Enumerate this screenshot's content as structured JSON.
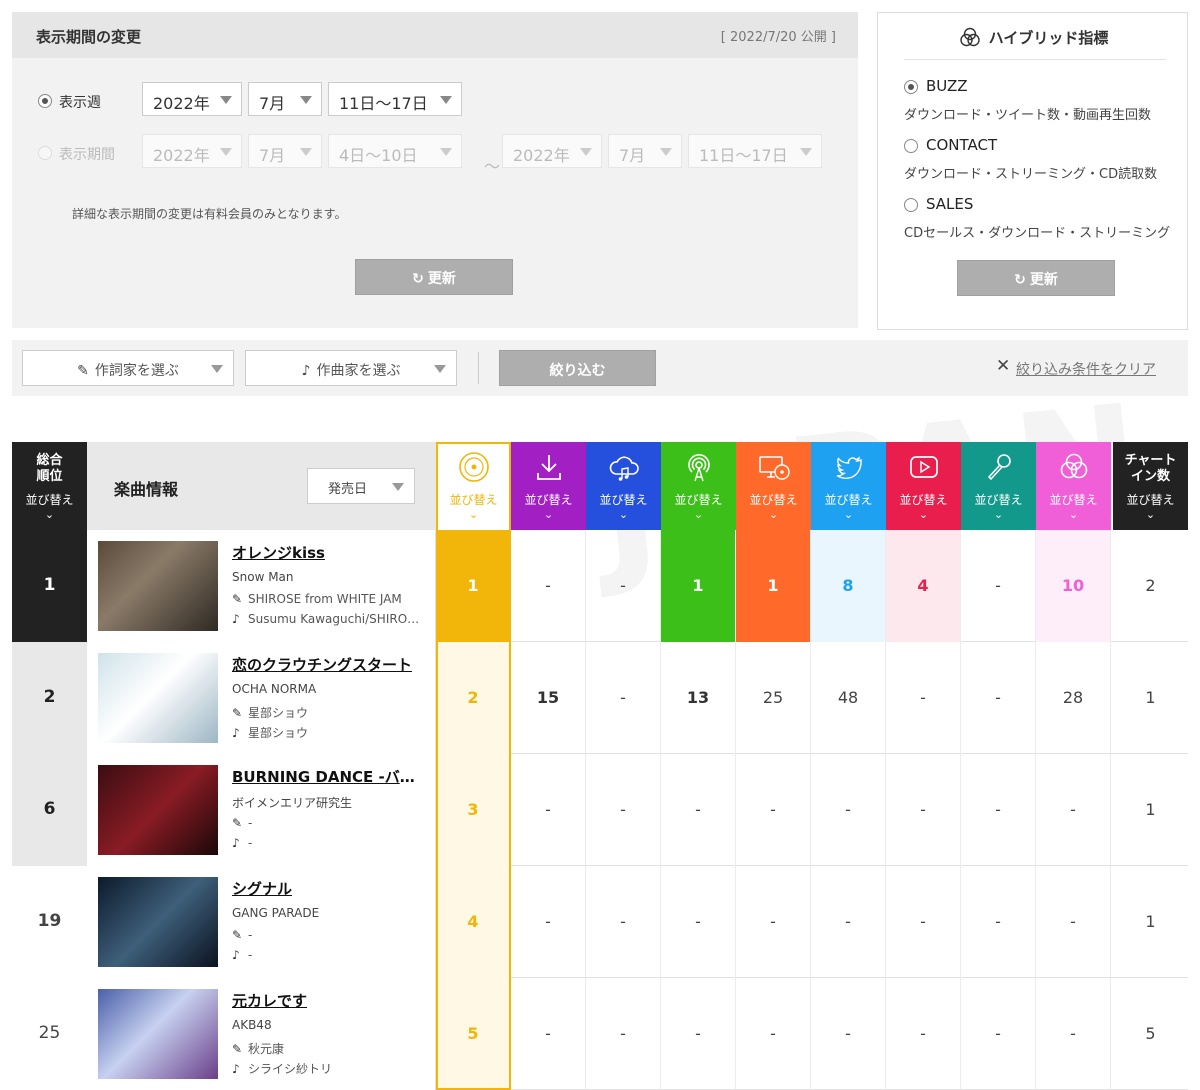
{
  "period": {
    "title": "表示期間の変更",
    "published": "[ 2022/7/20 公開 ]",
    "week_label": "表示週",
    "range_label": "表示期間",
    "week": {
      "year": "2022年",
      "month": "7月",
      "days": "11日～17日"
    },
    "range_from": {
      "year": "2022年",
      "month": "7月",
      "days": "4日～10日"
    },
    "tilde": "～",
    "range_to": {
      "year": "2022年",
      "month": "7月",
      "days": "11日～17日"
    },
    "note": "詳細な表示期間の変更は有料会員のみとなります。",
    "refresh_label": "更新"
  },
  "hybrid": {
    "title": "ハイブリッド指標",
    "options": [
      {
        "name": "BUZZ",
        "desc": "ダウンロード・ツイート数・動画再生回数",
        "selected": true
      },
      {
        "name": "CONTACT",
        "desc": "ダウンロード・ストリーミング・CD読取数",
        "selected": false
      },
      {
        "name": "SALES",
        "desc": "CDセールス・ダウンロード・ストリーミング",
        "selected": false
      }
    ],
    "refresh_label": "更新"
  },
  "filter": {
    "lyricist_placeholder": "作詞家を選ぶ",
    "composer_placeholder": "作曲家を選ぶ",
    "apply_label": "絞り込む",
    "clear_label": "絞り込み条件をクリア"
  },
  "watermark": "JAPAN",
  "table": {
    "header": {
      "rank_title_1": "総合",
      "rank_title_2": "順位",
      "sort_label": "並び替え",
      "info_title": "楽曲情報",
      "date_select": "発売日",
      "chartin_title_1": "チャート",
      "chartin_title_2": "イン数"
    },
    "columns": [
      {
        "key": "buzz",
        "icon": "hybrid-disc-icon",
        "color": "#f2b50a"
      },
      {
        "key": "download",
        "icon": "download-icon",
        "color": "#a21fc4"
      },
      {
        "key": "streaming",
        "icon": "cloud-music-icon",
        "color": "#2550dd"
      },
      {
        "key": "radio",
        "icon": "radio-icon",
        "color": "#3cbf18"
      },
      {
        "key": "cd",
        "icon": "pc-cd-icon",
        "color": "#ff6a2a"
      },
      {
        "key": "twitter",
        "icon": "twitter-icon",
        "color": "#1fa1f2"
      },
      {
        "key": "video",
        "icon": "video-play-icon",
        "color": "#ea1e4c"
      },
      {
        "key": "karaoke",
        "icon": "microphone-icon",
        "color": "#13998b"
      },
      {
        "key": "hybrid",
        "icon": "hybrid-icon",
        "color": "#f05fd8"
      }
    ],
    "rows": [
      {
        "rank": "1",
        "title": "オレンジkiss",
        "artist": "Snow Man",
        "lyricist": "SHIROSE from WHITE JAM",
        "composer": "Susumu Kawaguchi/SHIROSE from WHITE JAM",
        "values": [
          "1",
          "-",
          "-",
          "1",
          "1",
          "8",
          "4",
          "-",
          "10"
        ],
        "chart_in": "2"
      },
      {
        "rank": "2",
        "title": "恋のクラウチングスタート",
        "artist": "OCHA NORMA",
        "lyricist": "星部ショウ",
        "composer": "星部ショウ",
        "values": [
          "2",
          "15",
          "-",
          "13",
          "25",
          "48",
          "-",
          "-",
          "28"
        ],
        "chart_in": "1"
      },
      {
        "rank": "6",
        "title": "BURNING DANCE -バーニングダンス-",
        "artist": "ボイメンエリア研究生",
        "lyricist": "-",
        "composer": "-",
        "values": [
          "3",
          "-",
          "-",
          "-",
          "-",
          "-",
          "-",
          "-",
          "-"
        ],
        "chart_in": "1"
      },
      {
        "rank": "19",
        "title": "シグナル",
        "artist": "GANG PARADE",
        "lyricist": "-",
        "composer": "-",
        "values": [
          "4",
          "-",
          "-",
          "-",
          "-",
          "-",
          "-",
          "-",
          "-"
        ],
        "chart_in": "1"
      },
      {
        "rank": "25",
        "title": "元カレです",
        "artist": "AKB48",
        "lyricist": "秋元康",
        "composer": "シライシ紗トリ",
        "values": [
          "5",
          "-",
          "-",
          "-",
          "-",
          "-",
          "-",
          "-",
          "-"
        ],
        "chart_in": "5"
      }
    ]
  }
}
